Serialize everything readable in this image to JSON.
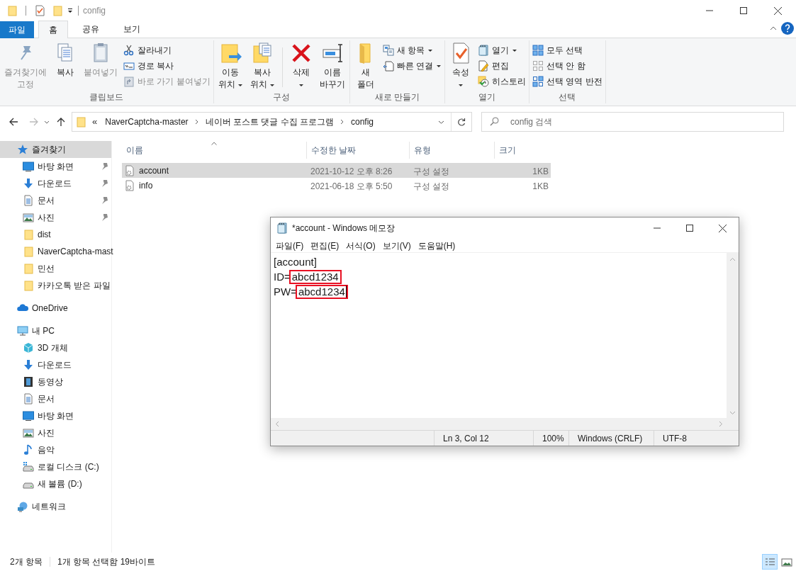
{
  "window": {
    "title": "config"
  },
  "ribbon_tabs": [
    {
      "label": "파일",
      "kind": "file",
      "selected": false
    },
    {
      "label": "홈",
      "kind": "tab",
      "selected": true
    },
    {
      "label": "공유",
      "kind": "tab",
      "selected": false
    },
    {
      "label": "보기",
      "kind": "tab",
      "selected": false
    }
  ],
  "ribbon_groups": [
    {
      "label": "클립보드",
      "large": [
        {
          "label": "즐겨찾기에\n고정",
          "disabled": true,
          "dropdown": false
        },
        {
          "label": "복사",
          "disabled": false,
          "dropdown": false
        },
        {
          "label": "붙여넣기",
          "disabled": true,
          "dropdown": false
        }
      ],
      "small": [
        {
          "label": "잘라내기",
          "disabled": false,
          "dropdown": false
        },
        {
          "label": "경로 복사",
          "disabled": false,
          "dropdown": false
        },
        {
          "label": "바로 가기 붙여넣기",
          "disabled": true,
          "dropdown": false
        }
      ]
    },
    {
      "label": "구성",
      "large": [
        {
          "label": "이동\n위치",
          "disabled": false,
          "dropdown": true
        },
        {
          "label": "복사\n위치",
          "disabled": false,
          "dropdown": true
        },
        {
          "label": "삭제",
          "disabled": false,
          "dropdown": true
        },
        {
          "label": "이름\n바꾸기",
          "disabled": false,
          "dropdown": false
        }
      ]
    },
    {
      "label": "새로 만들기",
      "large": [
        {
          "label": "새\n폴더",
          "disabled": false,
          "dropdown": false
        }
      ],
      "small": [
        {
          "label": "새 항목",
          "disabled": false,
          "dropdown": true
        },
        {
          "label": "빠른 연결",
          "disabled": false,
          "dropdown": true
        }
      ]
    },
    {
      "label": "열기",
      "large": [
        {
          "label": "속성",
          "disabled": false,
          "dropdown": true
        }
      ],
      "small": [
        {
          "label": "열기",
          "disabled": false,
          "dropdown": true
        },
        {
          "label": "편집",
          "disabled": false,
          "dropdown": false
        },
        {
          "label": "히스토리",
          "disabled": false,
          "dropdown": false
        }
      ]
    },
    {
      "label": "선택",
      "small": [
        {
          "label": "모두 선택",
          "disabled": false,
          "dropdown": false
        },
        {
          "label": "선택 안 함",
          "disabled": false,
          "dropdown": false
        },
        {
          "label": "선택 영역 반전",
          "disabled": false,
          "dropdown": false
        }
      ]
    }
  ],
  "address": {
    "overflow": "«",
    "path": [
      "NaverCaptcha-master",
      "네이버 포스트 댓글 수집 프로그램",
      "config"
    ]
  },
  "search": {
    "placeholder": "config 검색"
  },
  "nav": [
    {
      "label": "즐겨찾기",
      "selected": true,
      "pinned": false,
      "children": [
        {
          "label": "바탕 화면",
          "selected": false,
          "pinned": true
        },
        {
          "label": "다운로드",
          "selected": false,
          "pinned": true
        },
        {
          "label": "문서",
          "selected": false,
          "pinned": true
        },
        {
          "label": "사진",
          "selected": false,
          "pinned": true
        },
        {
          "label": "dist",
          "selected": false,
          "pinned": false
        },
        {
          "label": "NaverCaptcha-mast",
          "selected": false,
          "pinned": false
        },
        {
          "label": "민선",
          "selected": false,
          "pinned": false
        },
        {
          "label": "카카오톡 받은 파일",
          "selected": false,
          "pinned": false
        }
      ]
    },
    {
      "label": "OneDrive",
      "selected": false,
      "pinned": false
    },
    {
      "label": "내 PC",
      "selected": false,
      "pinned": false,
      "children": [
        {
          "label": "3D 개체",
          "selected": false,
          "pinned": false
        },
        {
          "label": "다운로드",
          "selected": false,
          "pinned": false
        },
        {
          "label": "동영상",
          "selected": false,
          "pinned": false
        },
        {
          "label": "문서",
          "selected": false,
          "pinned": false
        },
        {
          "label": "바탕 화면",
          "selected": false,
          "pinned": false
        },
        {
          "label": "사진",
          "selected": false,
          "pinned": false
        },
        {
          "label": "음악",
          "selected": false,
          "pinned": false
        },
        {
          "label": "로컬 디스크 (C:)",
          "selected": false,
          "pinned": false
        },
        {
          "label": "새 볼륨 (D:)",
          "selected": false,
          "pinned": false
        }
      ]
    },
    {
      "label": "네트워크",
      "selected": false,
      "pinned": false
    }
  ],
  "columns": [
    {
      "label": "이름",
      "sorted": true
    },
    {
      "label": "수정한 날짜",
      "sorted": false
    },
    {
      "label": "유형",
      "sorted": false
    },
    {
      "label": "크기",
      "sorted": false
    }
  ],
  "rows": [
    {
      "name": "account",
      "modified": "2021-10-12 오후 8:26",
      "type": "구성 설정",
      "size": "1KB",
      "selected": true
    },
    {
      "name": "info",
      "modified": "2021-06-18 오후 5:50",
      "type": "구성 설정",
      "size": "1KB",
      "selected": false
    }
  ],
  "notepad": {
    "title": "*account - Windows 메모장",
    "menu": [
      "파일(F)",
      "편집(E)",
      "서식(O)",
      "보기(V)",
      "도움말(H)"
    ],
    "lines": [
      {
        "kind": "plain",
        "text": "[account]"
      },
      {
        "kind": "pair",
        "key": "ID=",
        "value": "abcd1234",
        "highlighted": true,
        "cursor": false
      },
      {
        "kind": "pair",
        "key": "PW=",
        "value": "abcd1234",
        "highlighted": true,
        "cursor": true
      }
    ],
    "status": [
      "Ln 3, Col 12",
      "100%",
      "Windows (CRLF)",
      "UTF-8"
    ]
  },
  "status_bar": {
    "item_count": "2개 항목",
    "selection": "1개 항목 선택함 19바이트",
    "views": [
      {
        "kind": "details",
        "selected": true
      },
      {
        "kind": "thumbnails",
        "selected": false
      }
    ]
  }
}
